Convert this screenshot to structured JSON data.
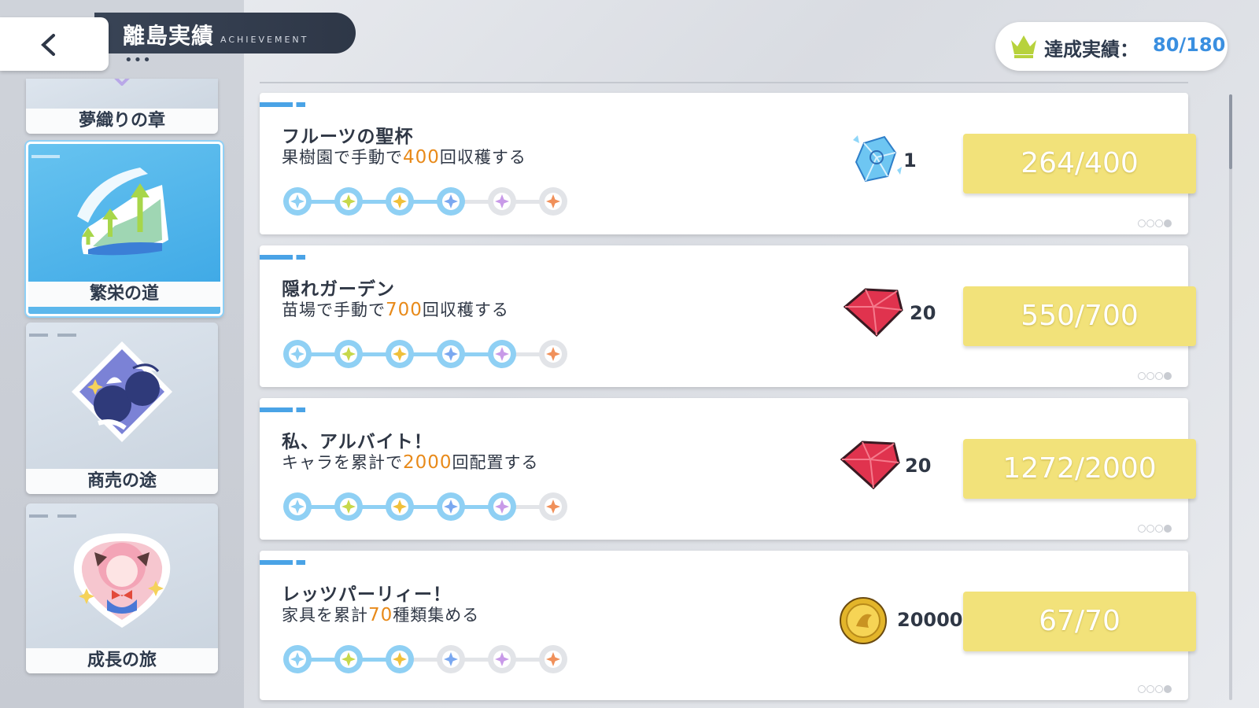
{
  "header": {
    "title": "離島実績",
    "subtitle": "ACHIEVEMENT",
    "dots": "•••"
  },
  "total": {
    "label": "達成実績：",
    "value": "80/180",
    "icon": "crown-icon"
  },
  "sidebar": {
    "items": [
      {
        "label": "夢織りの章",
        "active": false
      },
      {
        "label": "繁栄の道",
        "active": true
      },
      {
        "label": "商売の途",
        "active": false
      },
      {
        "label": "成長の旅",
        "active": false
      }
    ]
  },
  "achievements": [
    {
      "title": "フルーツの聖杯",
      "desc_pre": "果樹園で手動で",
      "desc_num": "400",
      "desc_post": "回収穫する",
      "stages_done": 4,
      "stages_total": 6,
      "reward_icon": "crystal-icon",
      "reward_qty": "1",
      "progress": "264/400"
    },
    {
      "title": "隠れガーデン",
      "desc_pre": "苗場で手動で",
      "desc_num": "700",
      "desc_post": "回収穫する",
      "stages_done": 5,
      "stages_total": 6,
      "reward_icon": "ruby-icon",
      "reward_qty": "20",
      "progress": "550/700"
    },
    {
      "title": "私、アルバイト！",
      "desc_pre": "キャラを累計で",
      "desc_num": "2000",
      "desc_post": "回配置する",
      "stages_done": 5,
      "stages_total": 6,
      "reward_icon": "ruby-icon",
      "reward_qty": "20",
      "progress": "1272/2000"
    },
    {
      "title": "レッツパーリィー！",
      "desc_pre": "家具を累計",
      "desc_num": "70",
      "desc_post": "種類集める",
      "stages_done": 3,
      "stages_total": 6,
      "reward_icon": "gold-coin-icon",
      "reward_qty": "20000",
      "progress": "67/70"
    }
  ],
  "colors": {
    "accent_blue": "#3a8fe0",
    "progress_yellow": "#f2e27a",
    "number_orange": "#e88a1a"
  }
}
